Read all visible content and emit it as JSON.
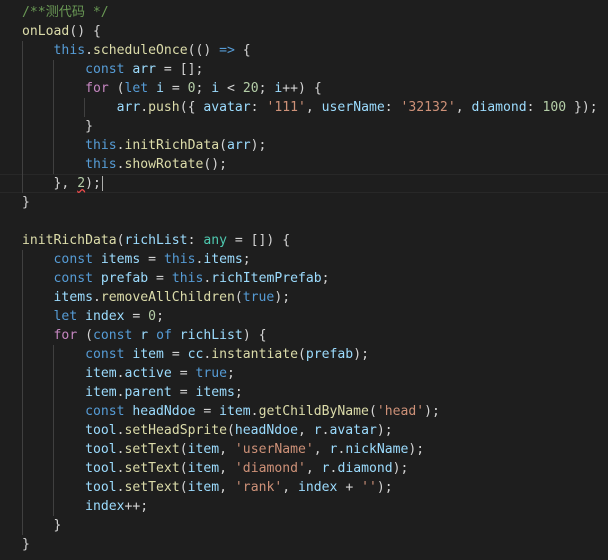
{
  "editor": {
    "language": "typescript",
    "current_line": 10,
    "colors": {
      "background": "#1e1e1e",
      "comment": "#6a9955",
      "keyword": "#569cd6",
      "control": "#c586c0",
      "function": "#dcdcaa",
      "variable": "#9cdcfe",
      "type": "#4ec9b0",
      "string": "#ce9178",
      "number": "#b5cea8",
      "plain": "#d4d4d4"
    },
    "lines": [
      {
        "indent": 0,
        "tokens": [
          [
            "c",
            "/**测代码 */"
          ]
        ]
      },
      {
        "indent": 0,
        "tokens": [
          [
            "f",
            "onLoad"
          ],
          [
            "p",
            "() {"
          ]
        ]
      },
      {
        "indent": 1,
        "tokens": [
          [
            "k",
            "this"
          ],
          [
            "p",
            "."
          ],
          [
            "f",
            "scheduleOnce"
          ],
          [
            "p",
            "(() "
          ],
          [
            "k",
            "=>"
          ],
          [
            "p",
            " {"
          ]
        ]
      },
      {
        "indent": 2,
        "tokens": [
          [
            "k",
            "const"
          ],
          [
            "p",
            " "
          ],
          [
            "v",
            "arr"
          ],
          [
            "p",
            " = [];"
          ]
        ]
      },
      {
        "indent": 2,
        "tokens": [
          [
            "x",
            "for"
          ],
          [
            "p",
            " ("
          ],
          [
            "k",
            "let"
          ],
          [
            "p",
            " "
          ],
          [
            "v",
            "i"
          ],
          [
            "p",
            " = "
          ],
          [
            "n",
            "0"
          ],
          [
            "p",
            "; "
          ],
          [
            "v",
            "i"
          ],
          [
            "p",
            " < "
          ],
          [
            "n",
            "20"
          ],
          [
            "p",
            "; "
          ],
          [
            "v",
            "i"
          ],
          [
            "p",
            "++) {"
          ]
        ]
      },
      {
        "indent": 3,
        "tokens": [
          [
            "v",
            "arr"
          ],
          [
            "p",
            "."
          ],
          [
            "f",
            "push"
          ],
          [
            "p",
            "({ "
          ],
          [
            "v",
            "avatar"
          ],
          [
            "p",
            ": "
          ],
          [
            "s",
            "'111'"
          ],
          [
            "p",
            ", "
          ],
          [
            "v",
            "userName"
          ],
          [
            "p",
            ": "
          ],
          [
            "s",
            "'32132'"
          ],
          [
            "p",
            ", "
          ],
          [
            "v",
            "diamond"
          ],
          [
            "p",
            ": "
          ],
          [
            "n",
            "100"
          ],
          [
            "p",
            " });"
          ]
        ]
      },
      {
        "indent": 2,
        "tokens": [
          [
            "p",
            "}"
          ]
        ]
      },
      {
        "indent": 2,
        "tokens": [
          [
            "k",
            "this"
          ],
          [
            "p",
            "."
          ],
          [
            "f",
            "initRichData"
          ],
          [
            "p",
            "("
          ],
          [
            "v",
            "arr"
          ],
          [
            "p",
            ");"
          ]
        ]
      },
      {
        "indent": 2,
        "tokens": [
          [
            "k",
            "this"
          ],
          [
            "p",
            "."
          ],
          [
            "f",
            "showRotate"
          ],
          [
            "p",
            "();"
          ]
        ]
      },
      {
        "indent": 1,
        "tokens": [
          [
            "p",
            "}, "
          ],
          [
            "e",
            "2"
          ],
          [
            "p",
            ");"
          ]
        ]
      },
      {
        "indent": 0,
        "tokens": [
          [
            "p",
            "}"
          ]
        ]
      },
      {
        "indent": 0,
        "tokens": []
      },
      {
        "indent": 0,
        "tokens": [
          [
            "f",
            "initRichData"
          ],
          [
            "p",
            "("
          ],
          [
            "v",
            "richList"
          ],
          [
            "p",
            ": "
          ],
          [
            "t",
            "any"
          ],
          [
            "p",
            " = []) {"
          ]
        ]
      },
      {
        "indent": 1,
        "tokens": [
          [
            "k",
            "const"
          ],
          [
            "p",
            " "
          ],
          [
            "v",
            "items"
          ],
          [
            "p",
            " = "
          ],
          [
            "k",
            "this"
          ],
          [
            "p",
            "."
          ],
          [
            "v",
            "items"
          ],
          [
            "p",
            ";"
          ]
        ]
      },
      {
        "indent": 1,
        "tokens": [
          [
            "k",
            "const"
          ],
          [
            "p",
            " "
          ],
          [
            "v",
            "prefab"
          ],
          [
            "p",
            " = "
          ],
          [
            "k",
            "this"
          ],
          [
            "p",
            "."
          ],
          [
            "v",
            "richItemPrefab"
          ],
          [
            "p",
            ";"
          ]
        ]
      },
      {
        "indent": 1,
        "tokens": [
          [
            "v",
            "items"
          ],
          [
            "p",
            "."
          ],
          [
            "f",
            "removeAllChildren"
          ],
          [
            "p",
            "("
          ],
          [
            "k",
            "true"
          ],
          [
            "p",
            ");"
          ]
        ]
      },
      {
        "indent": 1,
        "tokens": [
          [
            "k",
            "let"
          ],
          [
            "p",
            " "
          ],
          [
            "v",
            "index"
          ],
          [
            "p",
            " = "
          ],
          [
            "n",
            "0"
          ],
          [
            "p",
            ";"
          ]
        ]
      },
      {
        "indent": 1,
        "tokens": [
          [
            "x",
            "for"
          ],
          [
            "p",
            " ("
          ],
          [
            "k",
            "const"
          ],
          [
            "p",
            " "
          ],
          [
            "v",
            "r"
          ],
          [
            "p",
            " "
          ],
          [
            "k",
            "of"
          ],
          [
            "p",
            " "
          ],
          [
            "v",
            "richList"
          ],
          [
            "p",
            ") {"
          ]
        ]
      },
      {
        "indent": 2,
        "tokens": [
          [
            "k",
            "const"
          ],
          [
            "p",
            " "
          ],
          [
            "v",
            "item"
          ],
          [
            "p",
            " = "
          ],
          [
            "v",
            "cc"
          ],
          [
            "p",
            "."
          ],
          [
            "f",
            "instantiate"
          ],
          [
            "p",
            "("
          ],
          [
            "v",
            "prefab"
          ],
          [
            "p",
            ");"
          ]
        ]
      },
      {
        "indent": 2,
        "tokens": [
          [
            "v",
            "item"
          ],
          [
            "p",
            "."
          ],
          [
            "v",
            "active"
          ],
          [
            "p",
            " = "
          ],
          [
            "k",
            "true"
          ],
          [
            "p",
            ";"
          ]
        ]
      },
      {
        "indent": 2,
        "tokens": [
          [
            "v",
            "item"
          ],
          [
            "p",
            "."
          ],
          [
            "v",
            "parent"
          ],
          [
            "p",
            " = "
          ],
          [
            "v",
            "items"
          ],
          [
            "p",
            ";"
          ]
        ]
      },
      {
        "indent": 2,
        "tokens": [
          [
            "k",
            "const"
          ],
          [
            "p",
            " "
          ],
          [
            "v",
            "headNdoe"
          ],
          [
            "p",
            " = "
          ],
          [
            "v",
            "item"
          ],
          [
            "p",
            "."
          ],
          [
            "f",
            "getChildByName"
          ],
          [
            "p",
            "("
          ],
          [
            "s",
            "'head'"
          ],
          [
            "p",
            ");"
          ]
        ]
      },
      {
        "indent": 2,
        "tokens": [
          [
            "v",
            "tool"
          ],
          [
            "p",
            "."
          ],
          [
            "f",
            "setHeadSprite"
          ],
          [
            "p",
            "("
          ],
          [
            "v",
            "headNdoe"
          ],
          [
            "p",
            ", "
          ],
          [
            "v",
            "r"
          ],
          [
            "p",
            "."
          ],
          [
            "v",
            "avatar"
          ],
          [
            "p",
            ");"
          ]
        ]
      },
      {
        "indent": 2,
        "tokens": [
          [
            "v",
            "tool"
          ],
          [
            "p",
            "."
          ],
          [
            "f",
            "setText"
          ],
          [
            "p",
            "("
          ],
          [
            "v",
            "item"
          ],
          [
            "p",
            ", "
          ],
          [
            "s",
            "'userName'"
          ],
          [
            "p",
            ", "
          ],
          [
            "v",
            "r"
          ],
          [
            "p",
            "."
          ],
          [
            "v",
            "nickName"
          ],
          [
            "p",
            ");"
          ]
        ]
      },
      {
        "indent": 2,
        "tokens": [
          [
            "v",
            "tool"
          ],
          [
            "p",
            "."
          ],
          [
            "f",
            "setText"
          ],
          [
            "p",
            "("
          ],
          [
            "v",
            "item"
          ],
          [
            "p",
            ", "
          ],
          [
            "s",
            "'diamond'"
          ],
          [
            "p",
            ", "
          ],
          [
            "v",
            "r"
          ],
          [
            "p",
            "."
          ],
          [
            "v",
            "diamond"
          ],
          [
            "p",
            ");"
          ]
        ]
      },
      {
        "indent": 2,
        "tokens": [
          [
            "v",
            "tool"
          ],
          [
            "p",
            "."
          ],
          [
            "f",
            "setText"
          ],
          [
            "p",
            "("
          ],
          [
            "v",
            "item"
          ],
          [
            "p",
            ", "
          ],
          [
            "s",
            "'rank'"
          ],
          [
            "p",
            ", "
          ],
          [
            "v",
            "index"
          ],
          [
            "p",
            " + "
          ],
          [
            "s",
            "''"
          ],
          [
            "p",
            ");"
          ]
        ]
      },
      {
        "indent": 2,
        "tokens": [
          [
            "v",
            "index"
          ],
          [
            "p",
            "++;"
          ]
        ]
      },
      {
        "indent": 1,
        "tokens": [
          [
            "p",
            "}"
          ]
        ]
      },
      {
        "indent": 0,
        "tokens": [
          [
            "p",
            "}"
          ]
        ]
      }
    ]
  }
}
